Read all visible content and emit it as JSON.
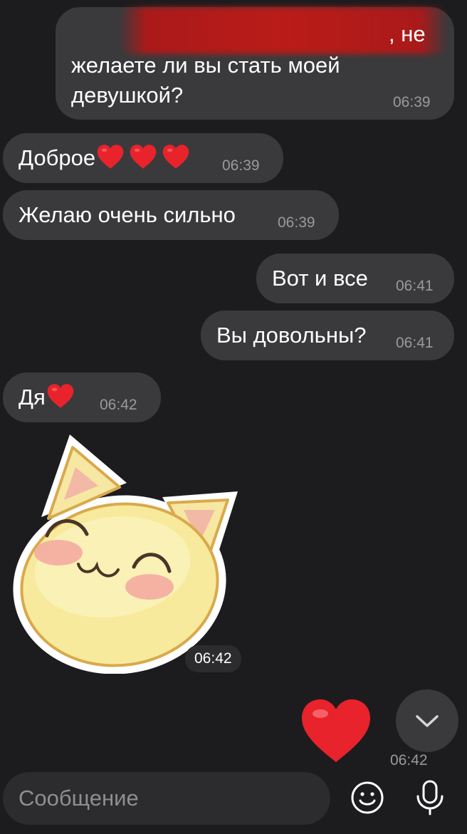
{
  "messages": [
    {
      "side": "out",
      "text_line1_tail": ", не",
      "text_line2": "желаете ли вы стать моей",
      "text_line3": "девушкой?",
      "time": "06:39"
    },
    {
      "side": "in",
      "text": "Доброе",
      "hearts": 3,
      "time": "06:39"
    },
    {
      "side": "in",
      "text": "Желаю очень сильно",
      "time": "06:39"
    },
    {
      "side": "out",
      "text": "Вот и все",
      "time": "06:41"
    },
    {
      "side": "out",
      "text": "Вы довольны?",
      "time": "06:41"
    },
    {
      "side": "in",
      "text": "Дя",
      "hearts": 1,
      "time": "06:42"
    },
    {
      "side": "in",
      "type": "sticker",
      "sticker": "smiling-cat-sticker",
      "time": "06:42"
    },
    {
      "side": "out",
      "type": "emoji",
      "emoji": "red-heart",
      "time": "06:42"
    }
  ],
  "composer": {
    "placeholder": "Сообщение",
    "emoji_icon": "smiley-icon",
    "mic_icon": "microphone-icon"
  },
  "scroll_down_icon": "chevron-down-icon",
  "colors": {
    "background": "#1c1c1e",
    "bubble": "#3a3a3c",
    "heart": "#e8232b",
    "redaction": "#c8191a"
  }
}
